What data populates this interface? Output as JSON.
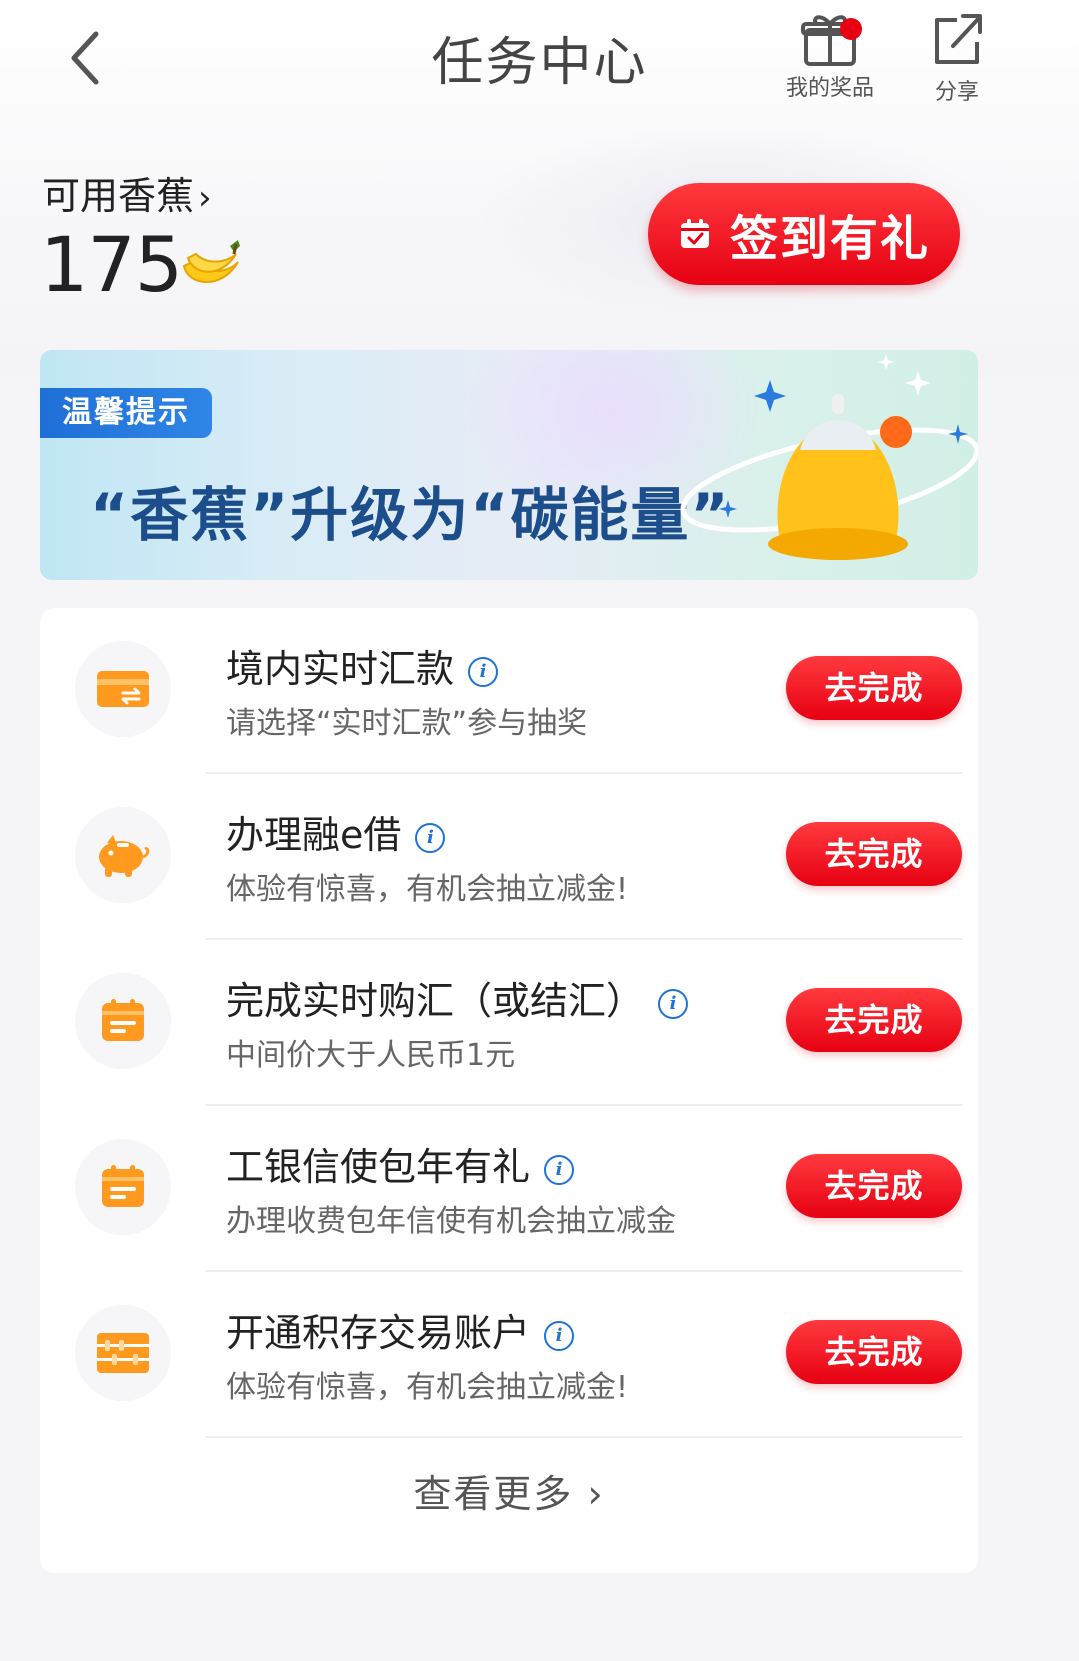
{
  "header": {
    "title": "任务中心",
    "prizes_label": "我的奖品",
    "share_label": "分享"
  },
  "balance": {
    "label": "可用香蕉",
    "value": "175"
  },
  "checkin": {
    "label": "签到有礼"
  },
  "banner": {
    "tag": "温馨提示",
    "text": "“香蕉”升级为“碳能量”"
  },
  "tasks": [
    {
      "title": "境内实时汇款",
      "desc": "请选择“实时汇款”参与抽奖",
      "button": "去完成",
      "icon": "card-transfer-icon"
    },
    {
      "title": "办理融e借",
      "desc": "体验有惊喜，有机会抽立减金!",
      "button": "去完成",
      "icon": "piggy-bank-icon"
    },
    {
      "title": "完成实时购汇（或结汇）",
      "desc": "中间价大于人民币1元",
      "button": "去完成",
      "icon": "calendar-icon"
    },
    {
      "title": "工银信使包年有礼",
      "desc": "办理收费包年信使有机会抽立减金",
      "button": "去完成",
      "icon": "calendar-icon"
    },
    {
      "title": "开通积存交易账户",
      "desc": "体验有惊喜，有机会抽立减金!",
      "button": "去完成",
      "icon": "abacus-icon"
    }
  ],
  "more_label": "查看更多",
  "colors": {
    "accent_red": "#e60012",
    "icon_orange": "#ff8a00",
    "info_blue": "#1e73d6"
  }
}
